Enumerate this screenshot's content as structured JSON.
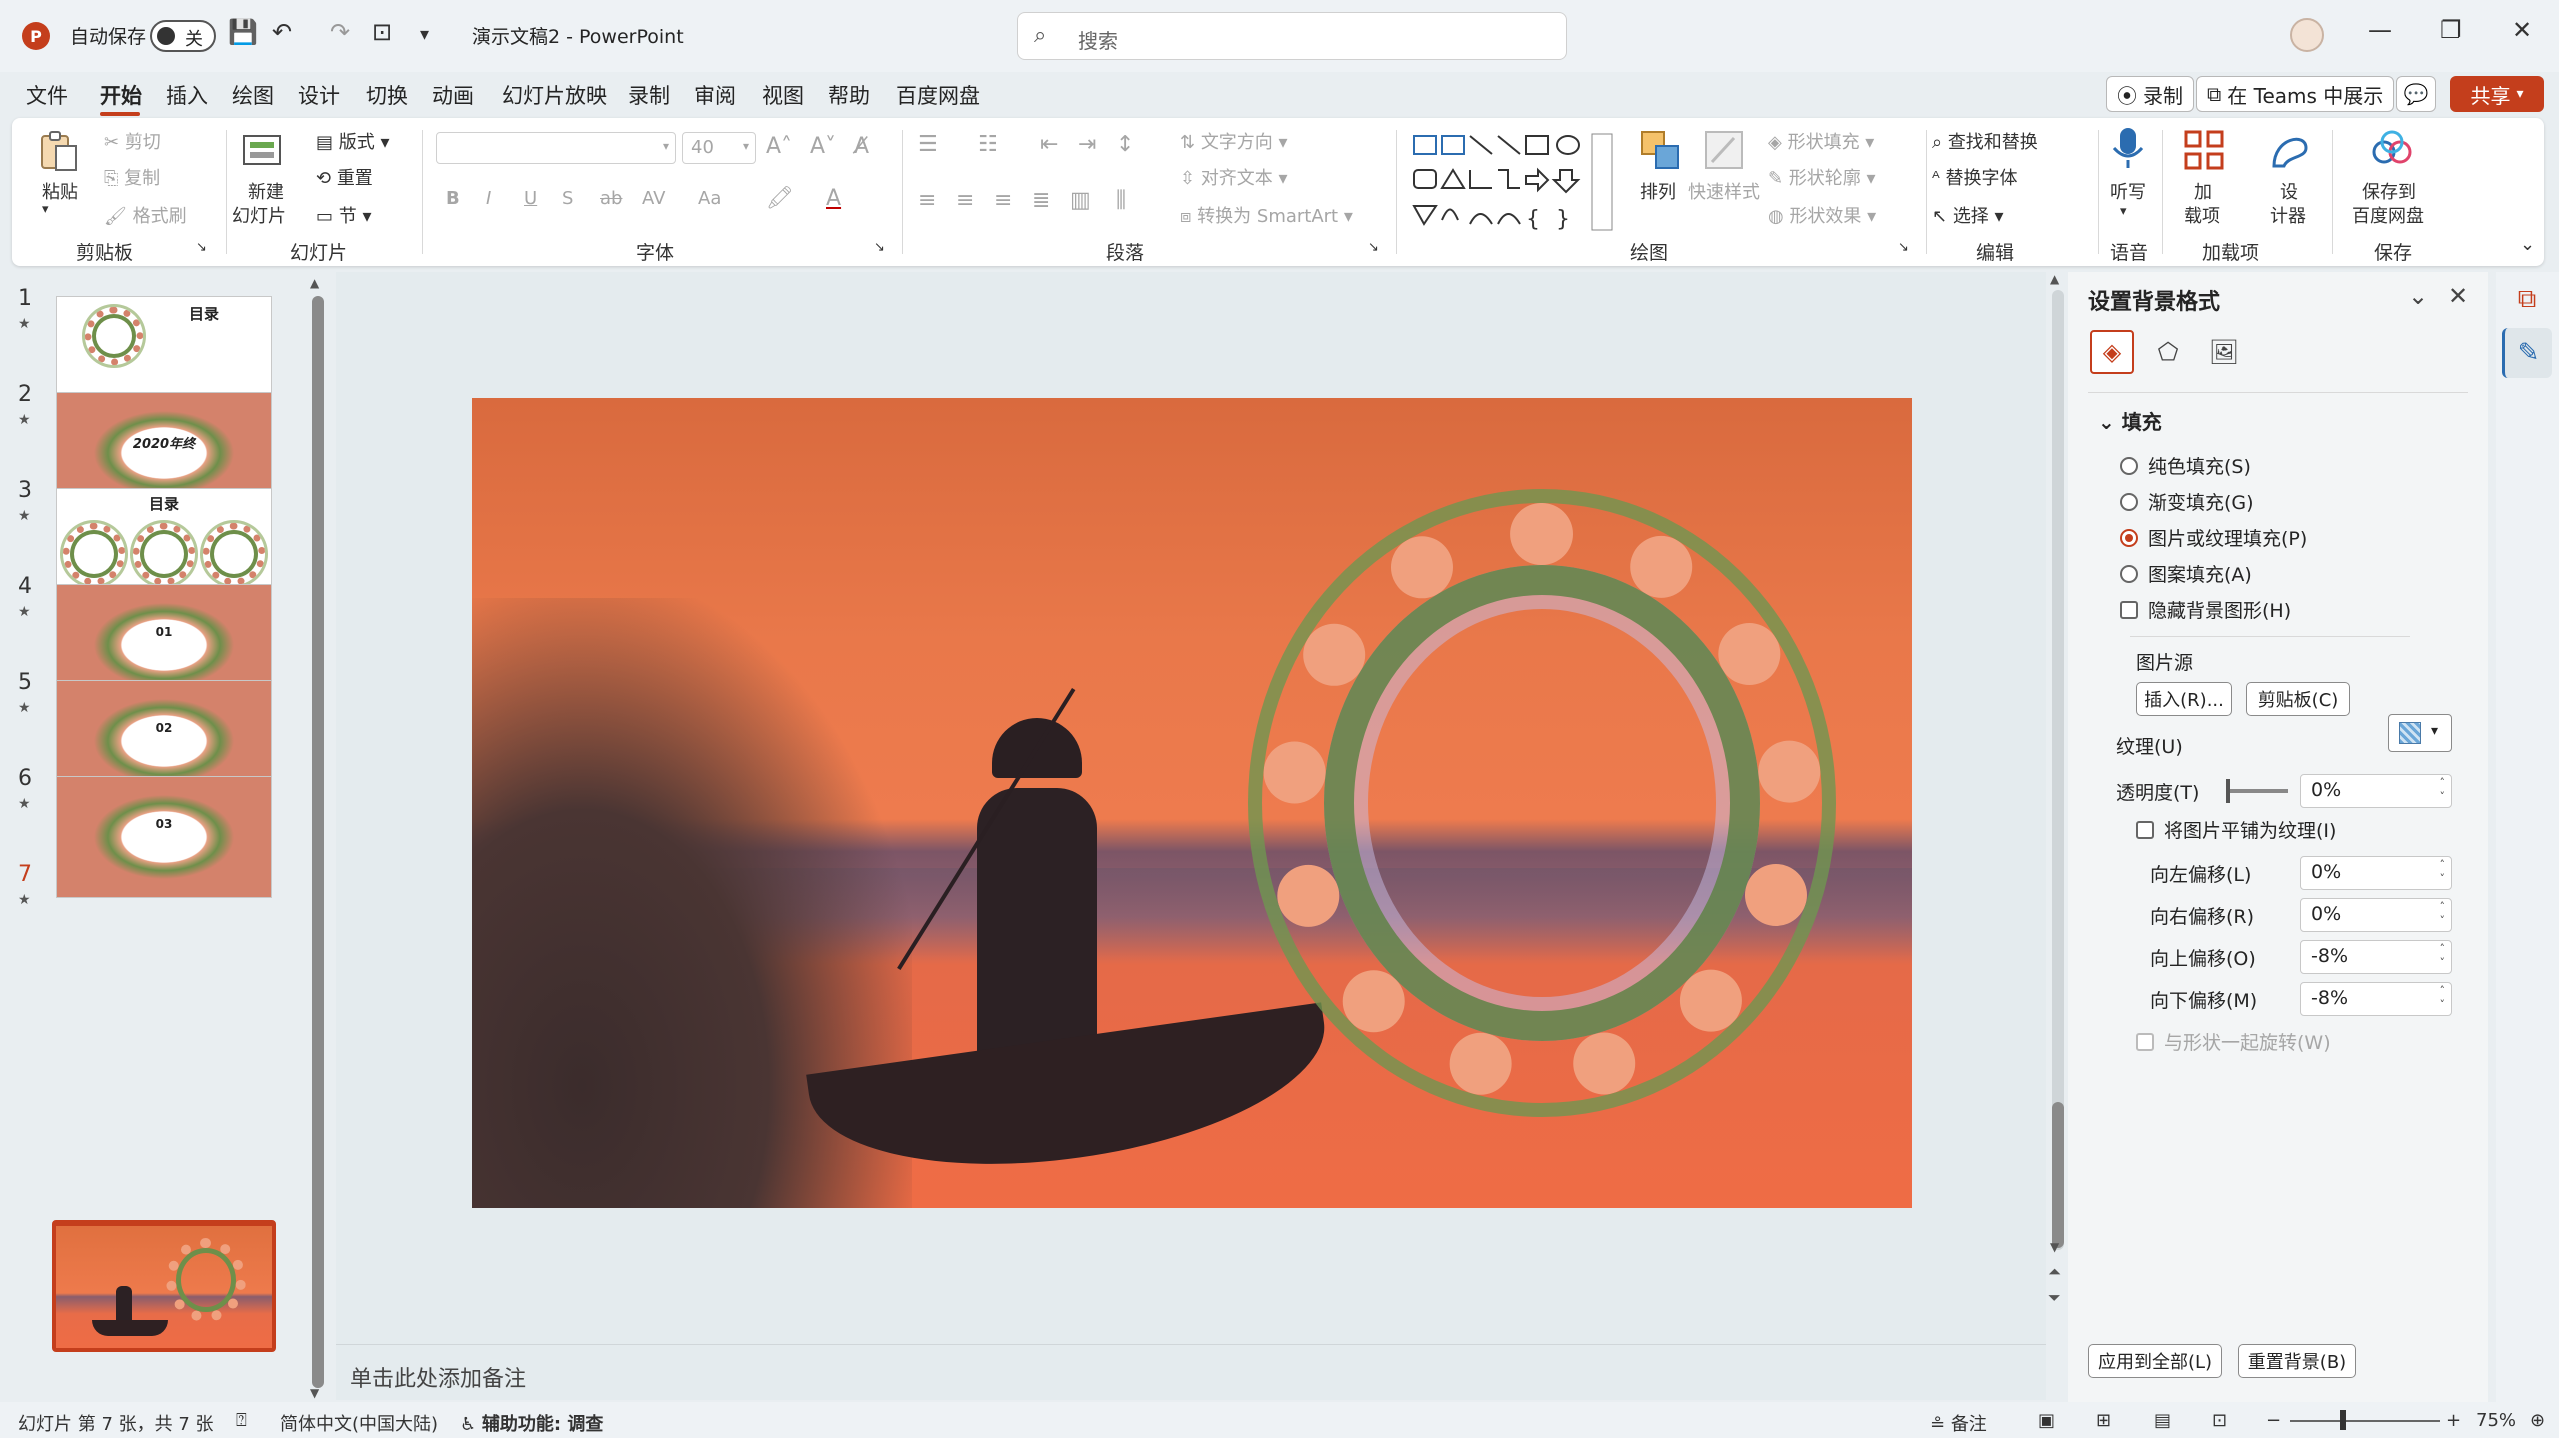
{
  "app": {
    "logo_letter": "P",
    "autosave_label": "自动保存",
    "autosave_state": "关",
    "doc_title": "演示文稿2  -  PowerPoint",
    "search_placeholder": "搜索",
    "icons": {
      "save": "💾",
      "undo": "↶",
      "redo": "↷",
      "present": "⊡",
      "more": "▾",
      "search": "⌕",
      "minimize": "—",
      "maximize": "❐",
      "close": "✕"
    }
  },
  "menu": {
    "items": [
      "文件",
      "开始",
      "插入",
      "绘图",
      "设计",
      "切换",
      "动画",
      "幻灯片放映",
      "录制",
      "审阅",
      "视图",
      "帮助",
      "百度网盘"
    ],
    "active_index": 1,
    "record_button": "录制",
    "teams_button": "在 Teams 中展示",
    "comment_icon": "💬",
    "share_button": "共享"
  },
  "ribbon": {
    "groups": [
      "剪贴板",
      "幻灯片",
      "字体",
      "段落",
      "绘图",
      "编辑",
      "语音",
      "加载项",
      "保存"
    ],
    "clipboard": {
      "paste": "粘贴",
      "cut": "剪切",
      "copy": "复制",
      "format_painter": "格式刷"
    },
    "slides": {
      "new_slide": "新建",
      "new_slide_line2": "幻灯片",
      "layout": "版式",
      "reset": "重置",
      "section": "节"
    },
    "font": {
      "size": "40",
      "bold": "B",
      "italic": "I",
      "underline": "U",
      "shadow": "S",
      "strike": "ab",
      "spacing": "AV",
      "case": "Aa"
    },
    "paragraph": {
      "text_direction": "文字方向",
      "align_text": "对齐文本",
      "smartart": "转换为 SmartArt"
    },
    "drawing": {
      "arrange": "排列",
      "quick_styles": "快速样式",
      "shape_fill": "形状填充",
      "shape_outline": "形状轮廓",
      "shape_effects": "形状效果"
    },
    "editing": {
      "find_replace": "查找和替换",
      "replace_font": "替换字体",
      "select": "选择"
    },
    "voice": {
      "dictate": "听写"
    },
    "addins": {
      "addins_line1": "加",
      "addins_line2": "载项",
      "designer_line1": "设",
      "designer_line2": "计器"
    },
    "save": {
      "line1": "保存到",
      "line2": "百度网盘"
    }
  },
  "thumbnails": [
    {
      "num": "1",
      "title": "目录",
      "kind": "toc-wreath"
    },
    {
      "num": "2",
      "title": "2020年终",
      "kind": "frame"
    },
    {
      "num": "3",
      "title": "目录",
      "kind": "three-wreaths"
    },
    {
      "num": "4",
      "title": "01",
      "kind": "frame"
    },
    {
      "num": "5",
      "title": "02",
      "kind": "frame"
    },
    {
      "num": "6",
      "title": "03",
      "kind": "frame"
    },
    {
      "num": "7",
      "title": "",
      "kind": "photo",
      "active": true
    }
  ],
  "notes_placeholder": "单击此处添加备注",
  "format_pane": {
    "title": "设置背景格式",
    "fill_section": "填充",
    "fill_options": [
      "纯色填充(S)",
      "渐变填充(G)",
      "图片或纹理填充(P)",
      "图案填充(A)"
    ],
    "selected_fill_index": 2,
    "hide_bg_graphics": "隐藏背景图形(H)",
    "picture_source": "图片源",
    "insert_button": "插入(R)...",
    "clipboard_button": "剪贴板(C)",
    "texture_label": "纹理(U)",
    "transparency_label": "透明度(T)",
    "transparency_value": "0%",
    "tile_label": "将图片平铺为纹理(I)",
    "offsets": [
      {
        "label": "向左偏移(L)",
        "value": "0%"
      },
      {
        "label": "向右偏移(R)",
        "value": "0%"
      },
      {
        "label": "向上偏移(O)",
        "value": "-8%"
      },
      {
        "label": "向下偏移(M)",
        "value": "-8%"
      }
    ],
    "rotate_with_shape": "与形状一起旋转(W)",
    "apply_all_button": "应用到全部(L)",
    "reset_bg_button": "重置背景(B)"
  },
  "statusbar": {
    "slide_info": "幻灯片 第 7 张，共 7 张",
    "language": "简体中文(中国大陆)",
    "accessibility": "辅助功能: 调查",
    "notes": "备注",
    "zoom": "75%"
  },
  "colors": {
    "accent": "#c43e1c",
    "ribbon_bg": "#ffffff",
    "app_bg": "#e9eef1"
  }
}
